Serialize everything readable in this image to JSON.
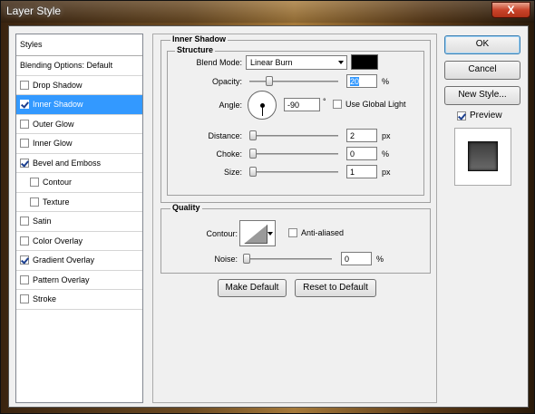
{
  "window": {
    "title": "Layer Style",
    "close_label": "X"
  },
  "styles_list": {
    "header": "Styles",
    "items": [
      {
        "label": "Blending Options: Default",
        "has_checkbox": false,
        "checked": false,
        "selected": false,
        "indent": false
      },
      {
        "label": "Drop Shadow",
        "has_checkbox": true,
        "checked": false,
        "selected": false,
        "indent": false
      },
      {
        "label": "Inner Shadow",
        "has_checkbox": true,
        "checked": true,
        "selected": true,
        "indent": false
      },
      {
        "label": "Outer Glow",
        "has_checkbox": true,
        "checked": false,
        "selected": false,
        "indent": false
      },
      {
        "label": "Inner Glow",
        "has_checkbox": true,
        "checked": false,
        "selected": false,
        "indent": false
      },
      {
        "label": "Bevel and Emboss",
        "has_checkbox": true,
        "checked": true,
        "selected": false,
        "indent": false
      },
      {
        "label": "Contour",
        "has_checkbox": true,
        "checked": false,
        "selected": false,
        "indent": true
      },
      {
        "label": "Texture",
        "has_checkbox": true,
        "checked": false,
        "selected": false,
        "indent": true
      },
      {
        "label": "Satin",
        "has_checkbox": true,
        "checked": false,
        "selected": false,
        "indent": false
      },
      {
        "label": "Color Overlay",
        "has_checkbox": true,
        "checked": false,
        "selected": false,
        "indent": false
      },
      {
        "label": "Gradient Overlay",
        "has_checkbox": true,
        "checked": true,
        "selected": false,
        "indent": false
      },
      {
        "label": "Pattern Overlay",
        "has_checkbox": true,
        "checked": false,
        "selected": false,
        "indent": false
      },
      {
        "label": "Stroke",
        "has_checkbox": true,
        "checked": false,
        "selected": false,
        "indent": false
      }
    ]
  },
  "inner_shadow": {
    "title": "Inner Shadow",
    "structure": {
      "title": "Structure",
      "blend_mode_label": "Blend Mode:",
      "blend_mode_value": "Linear Burn",
      "color_swatch": "#000000",
      "opacity_label": "Opacity:",
      "opacity_value": "20",
      "opacity_percent": 20,
      "opacity_unit": "%",
      "angle_label": "Angle:",
      "angle_value": "-90",
      "angle_unit": "°",
      "use_global_light_label": "Use Global Light",
      "use_global_light_checked": false,
      "distance_label": "Distance:",
      "distance_value": "2",
      "distance_unit": "px",
      "choke_label": "Choke:",
      "choke_value": "0",
      "choke_unit": "%",
      "size_label": "Size:",
      "size_value": "1",
      "size_unit": "px"
    },
    "quality": {
      "title": "Quality",
      "contour_label": "Contour:",
      "anti_aliased_label": "Anti-aliased",
      "anti_aliased_checked": false,
      "noise_label": "Noise:",
      "noise_value": "0",
      "noise_unit": "%"
    },
    "make_default_label": "Make Default",
    "reset_default_label": "Reset to Default"
  },
  "actions": {
    "ok_label": "OK",
    "cancel_label": "Cancel",
    "new_style_label": "New Style...",
    "preview_label": "Preview",
    "preview_checked": true
  }
}
